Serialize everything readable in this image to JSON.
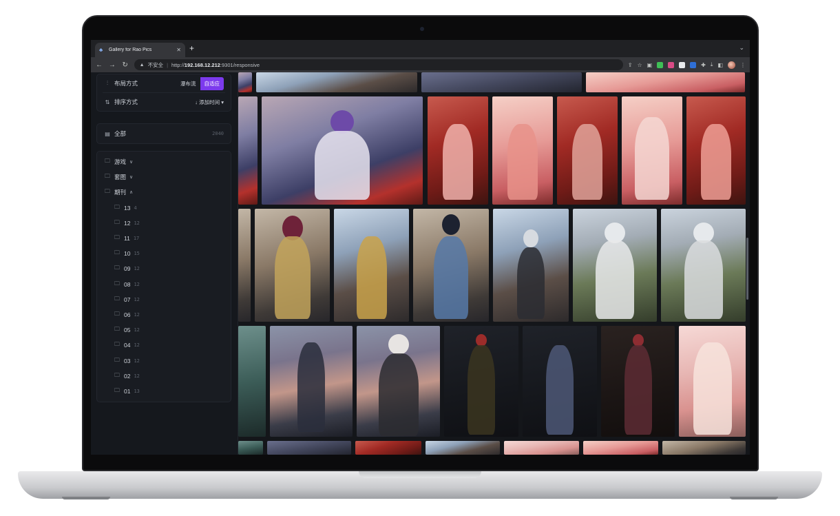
{
  "browser": {
    "tab_title": "Gallery for Rao Pics",
    "security_label": "不安全",
    "url_scheme": "http://",
    "url_host": "192.168.12.212",
    "url_rest": ":9301/responsive"
  },
  "sidebar": {
    "layout": {
      "label": "布局方式",
      "options": [
        "瀑布流",
        "自适应"
      ],
      "selected": "自适应"
    },
    "sort": {
      "label": "排序方式",
      "value": "添加时间"
    },
    "all": {
      "label": "全部",
      "count": "2040"
    },
    "folders": [
      {
        "label": "游戏",
        "expanded": false
      },
      {
        "label": "套图",
        "expanded": false
      },
      {
        "label": "期刊",
        "expanded": true
      }
    ],
    "subfolders": [
      {
        "label": "13",
        "count": "4"
      },
      {
        "label": "12",
        "count": "12"
      },
      {
        "label": "11",
        "count": "17"
      },
      {
        "label": "10",
        "count": "15"
      },
      {
        "label": "09",
        "count": "12"
      },
      {
        "label": "08",
        "count": "12"
      },
      {
        "label": "07",
        "count": "12"
      },
      {
        "label": "06",
        "count": "12"
      },
      {
        "label": "05",
        "count": "12"
      },
      {
        "label": "04",
        "count": "12"
      },
      {
        "label": "03",
        "count": "12"
      },
      {
        "label": "02",
        "count": "12"
      },
      {
        "label": "01",
        "count": "13"
      }
    ]
  },
  "colors": {
    "accent": "#7c3aed",
    "sidebar_bg": "#15181d",
    "gallery_bg": "#14161a"
  }
}
